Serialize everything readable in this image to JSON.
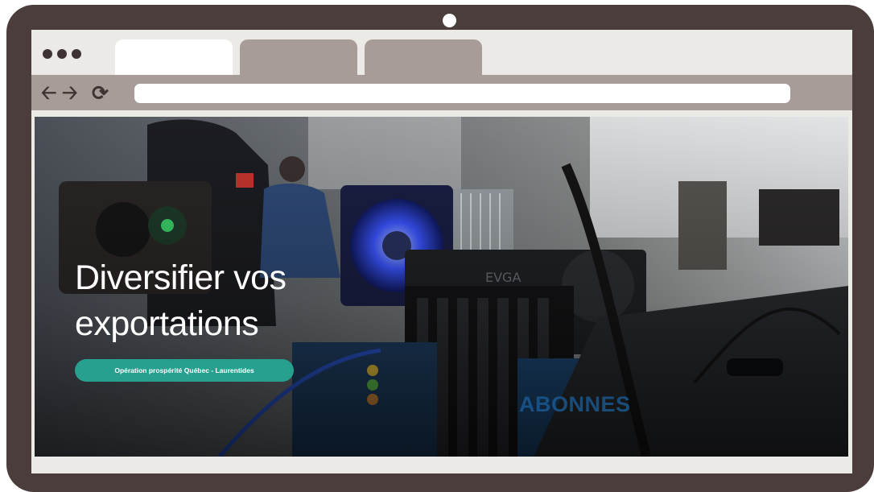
{
  "browser": {
    "tabs": [
      {
        "label": "",
        "active": true
      },
      {
        "label": "",
        "active": false
      },
      {
        "label": "",
        "active": false
      }
    ],
    "nav": {
      "back_icon": "arrow-left-icon",
      "forward_icon": "arrow-right-icon",
      "reload_icon": "reload-icon"
    },
    "address_value": ""
  },
  "hero": {
    "title_line1": "Diversifier vos",
    "title_line2": "exportations",
    "button_label": "Opération prospérité Québec - Laurentides",
    "watermark": "ABONNES"
  },
  "colors": {
    "frame": "#4a3d3b",
    "tab_inactive": "#a79c97",
    "accent_button": "#28a090",
    "screen_bg": "#ebeae6"
  }
}
